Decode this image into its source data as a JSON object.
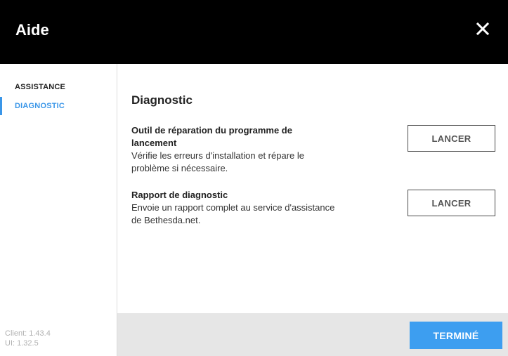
{
  "header": {
    "title": "Aide",
    "close_icon": "close-icon"
  },
  "sidebar": {
    "items": [
      {
        "label": "ASSISTANCE",
        "active": false
      },
      {
        "label": "DIAGNOSTIC",
        "active": true
      }
    ],
    "version_client": "Client: 1.43.4",
    "version_ui": "UI: 1.32.5"
  },
  "main": {
    "section_title": "Diagnostic",
    "tools": [
      {
        "title": "Outil de réparation du programme de lancement",
        "description": "Vérifie les erreurs d'installation et répare le problème si nécessaire.",
        "button_label": "LANCER"
      },
      {
        "title": "Rapport de diagnostic",
        "description": "Envoie un rapport complet au service d'assistance de Bethesda.net.",
        "button_label": "LANCER"
      }
    ]
  },
  "footer": {
    "done_label": "TERMINÉ"
  },
  "colors": {
    "header_bg": "#000000",
    "accent": "#3a96e8",
    "done_button": "#3d9ef0",
    "footer_bg": "#e6e6e6"
  }
}
